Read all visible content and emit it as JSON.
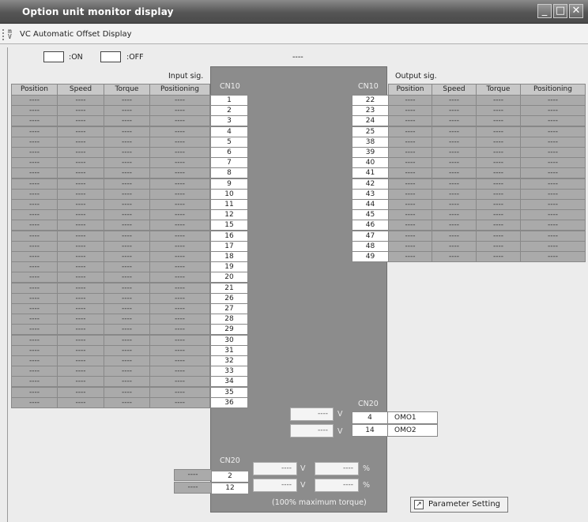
{
  "window": {
    "title": "Option unit monitor display",
    "buttons": {
      "minimize": "_",
      "maximize": "□",
      "close": "✕"
    }
  },
  "toolbar": {
    "icon_text": "m V\n⊞",
    "label": "VC Automatic Offset Display"
  },
  "legend": {
    "on_label": ":ON",
    "off_label": ":OFF",
    "top_value": "----"
  },
  "input": {
    "title": "Input sig.",
    "headers": [
      "Position",
      "Speed",
      "Torque",
      "Positioning"
    ],
    "connector": "CN10",
    "pins": [
      "1",
      "2",
      "3",
      "4",
      "5",
      "6",
      "7",
      "8",
      "9",
      "10",
      "11",
      "12",
      "15",
      "16",
      "17",
      "18",
      "19",
      "20",
      "21",
      "26",
      "27",
      "28",
      "29",
      "30",
      "31",
      "32",
      "33",
      "34",
      "35",
      "36"
    ],
    "cell_value": "----"
  },
  "output": {
    "title": "Output sig.",
    "headers": [
      "Position",
      "Speed",
      "Torque",
      "Positioning"
    ],
    "connector": "CN10",
    "pins": [
      "22",
      "23",
      "24",
      "25",
      "38",
      "39",
      "40",
      "41",
      "42",
      "43",
      "44",
      "45",
      "46",
      "47",
      "48",
      "49"
    ],
    "cell_value": "----"
  },
  "analog_out": {
    "connector": "CN20",
    "rows": [
      {
        "value": "----",
        "unit": "V",
        "pin": "4",
        "name": "OMO1"
      },
      {
        "value": "----",
        "unit": "V",
        "pin": "14",
        "name": "OMO2"
      }
    ]
  },
  "analog_in": {
    "connector": "CN20",
    "rows": [
      {
        "value": "----",
        "pin": "2",
        "v_value": "----",
        "v_unit": "V",
        "p_value": "----",
        "p_unit": "%"
      },
      {
        "value": "----",
        "pin": "12",
        "v_value": "----",
        "v_unit": "V",
        "p_value": "----",
        "p_unit": "%"
      }
    ],
    "note": "(100% maximum torque)"
  },
  "param_button": {
    "label": "Parameter Setting",
    "icon": "↗"
  }
}
